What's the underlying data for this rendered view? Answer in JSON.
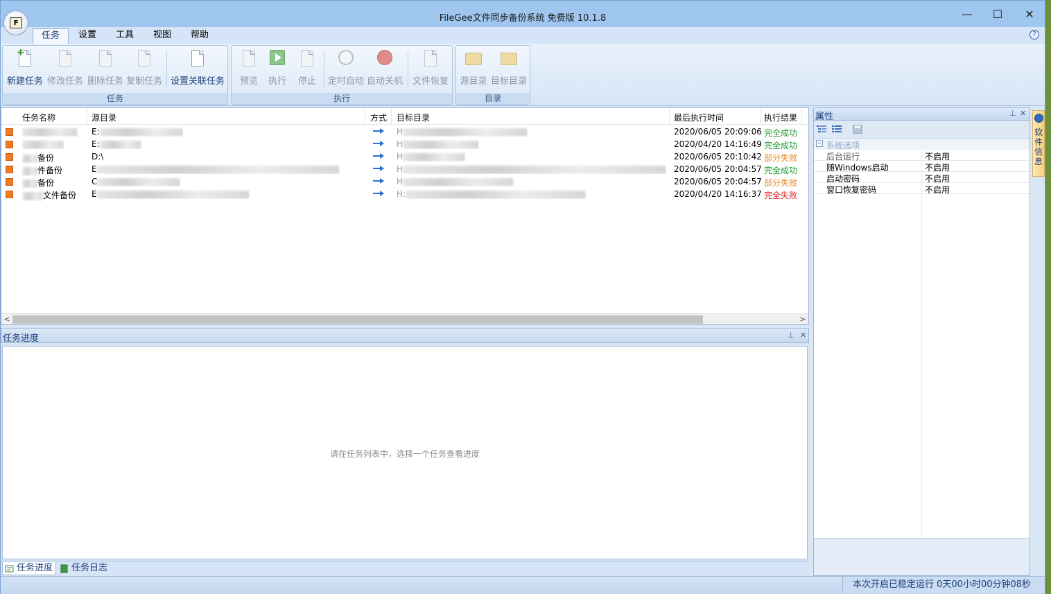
{
  "window": {
    "title": "FileGee文件同步备份系统 免费版 10.1.8",
    "icon_letter": "F",
    "min_glyph": "—",
    "max_glyph": "☐",
    "close_glyph": "✕"
  },
  "ribbon_tabs": [
    "任务",
    "设置",
    "工具",
    "视图",
    "帮助"
  ],
  "help_glyph": "?",
  "ribbon": {
    "groups": [
      {
        "label": "任务",
        "buttons": [
          "新建任务",
          "修改任务",
          "删除任务",
          "复制任务",
          "设置关联任务"
        ]
      },
      {
        "label": "执行",
        "buttons": [
          "预览",
          "执行",
          "停止",
          "定时自动",
          "自动关机",
          "文件恢复"
        ]
      },
      {
        "label": "目录",
        "buttons": [
          "源目录",
          "目标目录"
        ]
      }
    ]
  },
  "task_table": {
    "columns": [
      "任务名称",
      "源目录",
      "方式",
      "目标目录",
      "最后执行时间",
      "执行结果"
    ],
    "rows": [
      {
        "name_visible": "",
        "source_visible": "E:",
        "dest_visible": "H",
        "time": "2020/06/05 20:09:06",
        "result": "完全成功",
        "status": "ok"
      },
      {
        "name_visible": "",
        "source_visible": "E:",
        "dest_visible": "H",
        "time": "2020/04/20 14:16:49",
        "result": "完全成功",
        "status": "ok"
      },
      {
        "name_visible": "备份",
        "source_visible": "D:\\",
        "dest_visible": "H",
        "time": "2020/06/05 20:10:42",
        "result": "部分失败",
        "status": "partial"
      },
      {
        "name_visible": "件备份",
        "source_visible": "E",
        "dest_visible": "H",
        "time": "2020/06/05 20:04:57",
        "result": "完全成功",
        "status": "ok"
      },
      {
        "name_visible": "备份",
        "source_visible": "C",
        "dest_visible": "H",
        "time": "2020/06/05 20:04:57",
        "result": "部分失败",
        "status": "partial"
      },
      {
        "name_visible": "文件备份",
        "source_visible": "E",
        "dest_visible": "H:",
        "time": "2020/04/20 14:16:37",
        "result": "完全失败",
        "status": "fail"
      }
    ]
  },
  "progress_panel": {
    "title": "任务进度",
    "hint": "请在任务列表中，选择一个任务查看进度"
  },
  "bottom_tabs": [
    "任务进度",
    "任务日志"
  ],
  "properties_panel": {
    "title": "属性",
    "category": "系统选项",
    "items": [
      {
        "name": "后台运行",
        "value": "不启用"
      },
      {
        "name": "随Windows启动",
        "value": "不启用"
      },
      {
        "name": "启动密码",
        "value": "不启用"
      },
      {
        "name": "窗口恢复密码",
        "value": "不启用"
      }
    ]
  },
  "side_tab": "软件信息",
  "status_bar": "本次开启已稳定运行 0天00小时00分钟08秒",
  "colors": {
    "ok": "#1f9a2c",
    "partial": "#e6871a",
    "fail": "#e21d1d",
    "accent": "#1e3f78"
  }
}
